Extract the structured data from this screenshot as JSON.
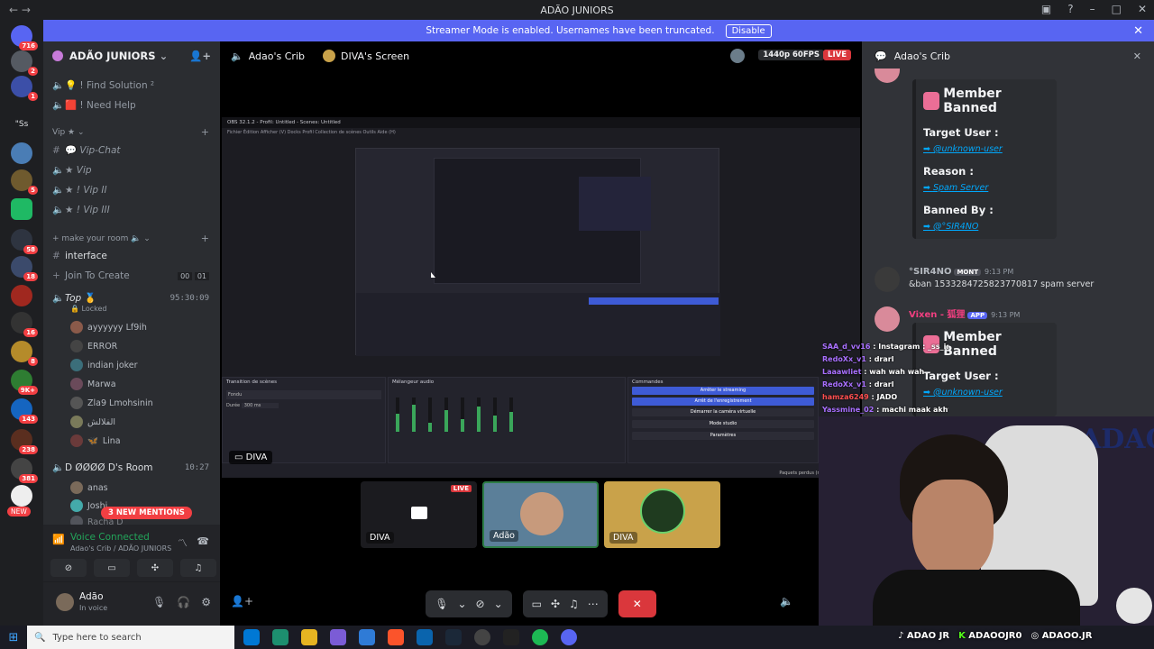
{
  "window": {
    "title": "ADÃO JUNIORS"
  },
  "banner": {
    "text": "Streamer Mode is enabled. Usernames have been truncated.",
    "button": "Disable"
  },
  "rail": {
    "badges": [
      "716",
      "2",
      "1",
      "5",
      "58",
      "18",
      "16",
      "8",
      "9K+",
      "143",
      "238",
      "381",
      "NEW"
    ],
    "third_label": "\"Ss"
  },
  "guild": {
    "name": "ADÃO JUNIORS"
  },
  "channels": [
    {
      "label": "! Find Solution ²"
    },
    {
      "label": "! Need Help"
    },
    {
      "label": "Vip ★"
    },
    {
      "label": "Vip-Chat"
    },
    {
      "label": "Vip"
    },
    {
      "label": "! Vip II"
    },
    {
      "label": "! Vip III"
    },
    {
      "label": "make your room"
    },
    {
      "label": "interface"
    },
    {
      "label": "Join To Create"
    },
    {
      "label": "Top"
    },
    {
      "label": "Locked"
    },
    {
      "label": "D ØØØØ D's Room"
    }
  ],
  "join_counts": [
    "00",
    "01"
  ],
  "voice_users_top": [
    "ayyyyyy Lf9ih",
    "ERROR",
    "indian joker",
    "Marwa",
    "Zla9 Lmohsinin",
    "الفلالش",
    "Lina"
  ],
  "voice_users_room": [
    "anas",
    "Joshi",
    "Racha D"
  ],
  "timers": {
    "top": "95:30:09",
    "room": "10:27"
  },
  "mentions": "3 NEW MENTIONS",
  "voice_panel": {
    "status": "Voice Connected",
    "server": "Adao's Crib / ADÃO JUNIORS"
  },
  "user": {
    "name": "Adão",
    "status": "In voice"
  },
  "stage": {
    "channel": "Adao's Crib",
    "screen": "DIVA's Screen",
    "quality": "1440p 60FPS",
    "live": "LIVE",
    "stream_label": "DIVA"
  },
  "obs": {
    "titlebar": "OBS 32.1.2 - Profil: Untitled - Scenes: Untitled",
    "menu": "Fichier   Édition   Afficher (V)   Docks   Profil   Collection de scènes   Outils   Aide (H)",
    "transition_header": "Transition de scènes",
    "mixer_header": "Mélangeur audio",
    "commands_header": "Commandes",
    "commands": [
      "Arrêter le streaming",
      "Arrêt de l'enregistrement",
      "Démarrer la caméra virtuelle",
      "Mode studio",
      "Paramètres"
    ],
    "fade": "Fondu",
    "duration": "Durée",
    "duration_value": "300 ms",
    "footer": "Paquets perdus (réseau): 0 (0.0%)"
  },
  "tiles": [
    {
      "label": "DIVA",
      "live": "LIVE"
    },
    {
      "label": "Adão"
    },
    {
      "label": "DIVA"
    }
  ],
  "chat": {
    "header": "Adao's Crib",
    "embed1": {
      "title": "Member Banned",
      "target_label": "Target User :",
      "target": "@unknown-user",
      "reason_label": "Reason :",
      "reason": "Spam Server",
      "banned_label": "Banned By :",
      "banned": "@°SIR4NO"
    },
    "msg1": {
      "name": "°SIR4NO",
      "tag": "MONT",
      "time": "9:13 PM",
      "text": "&ban 1533284725823770817 spam server"
    },
    "msg2": {
      "name": "Vixen - 狐狸",
      "tag": "APP",
      "time": "9:13 PM"
    },
    "embed2": {
      "title": "Member Banned",
      "target_label": "Target User :",
      "target": "@unknown-user"
    }
  },
  "twitch_chat": [
    {
      "user": "SAA_d_vv16",
      "msg": "Instagram : _ss_id16"
    },
    {
      "user": "RedoXx_v1",
      "msg": "drarl"
    },
    {
      "user": "Laaawliet",
      "msg": "wah wah wah"
    },
    {
      "user": "RedoXx_v1",
      "msg": "drarl"
    },
    {
      "user": "hamza6249",
      "msg": "JADO"
    },
    {
      "user": "Yassmine_02",
      "msg": "machi maak akhti"
    }
  ],
  "socials": [
    "ADAO JR",
    "ADAOOJR0",
    "ADAOO.JR"
  ],
  "cam_sign": "ADAO",
  "taskbar": {
    "search": "Type here to search"
  },
  "colors": {
    "blurple": "#5865f2",
    "live": "#da373c",
    "connected": "#23a55a",
    "link": "#00a8fc"
  }
}
